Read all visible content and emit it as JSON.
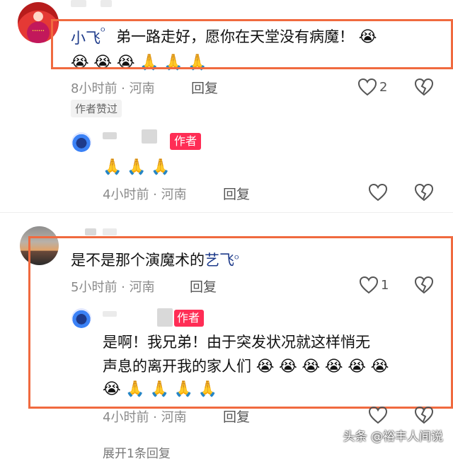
{
  "comment1": {
    "user": "小飞",
    "search_mark": "ᴼ",
    "avatar_text": "••••••",
    "text": "弟一路走好，愿你在天堂没有病魔！",
    "emoji_line1": [
      "😭"
    ],
    "emoji_line2": [
      "😭",
      "😭",
      "😭",
      "🙏",
      "🙏",
      "🙏"
    ],
    "meta": "8小时前 · 河南",
    "reply": "回复",
    "likes": "2",
    "author_liked": "作者赞过"
  },
  "reply1": {
    "tag": "作者",
    "emojis": [
      "🙏",
      "🙏",
      "🙏"
    ],
    "meta": "4小时前 · 河南",
    "reply": "回复"
  },
  "comment2": {
    "text_prefix": "是不是那个演魔术的",
    "text_link": "艺飞",
    "search_mark": "ᴼ",
    "meta": "5小时前 · 河南",
    "reply": "回复",
    "likes": "1"
  },
  "reply2": {
    "tag": "作者",
    "line1": "是啊！我兄弟！由于突发状况就这样悄无",
    "line2_text": "声息的离开我的家人们",
    "line2_emojis": [
      "😭",
      "😭",
      "😭",
      "😭",
      "😭",
      "😭"
    ],
    "line3_emojis": [
      "😭",
      "🙏",
      "🙏",
      "🙏",
      "🙏"
    ],
    "meta": "4小时前 · 河南",
    "reply": "回复"
  },
  "footer": {
    "expand": "展开1条回复"
  },
  "watermark": "头条 @裕丰人间说",
  "colors": {
    "highlight_box": "#f06a3f",
    "author_tag": "#ff2d55",
    "user_link": "#1d3a8a"
  }
}
